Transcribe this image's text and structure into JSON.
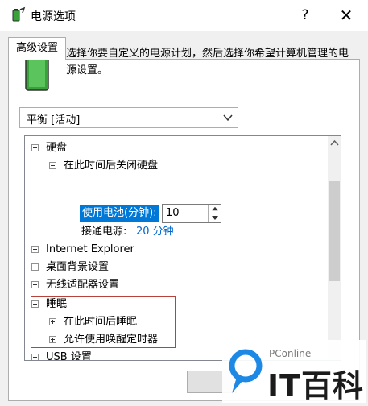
{
  "window": {
    "title": "电源选项",
    "help_label": "?",
    "close_label": "✕"
  },
  "tabs": [
    {
      "label": "高级设置"
    }
  ],
  "description": "选择你要自定义的电源计划，然后选择你希望计算机管理的电源设置。",
  "plan_select": {
    "value": "平衡 [活动]"
  },
  "settings_tree": {
    "hard_disk": {
      "label": "硬盘",
      "turn_off_after": {
        "label": "在此时间后关闭硬盘",
        "on_battery_label": "使用电池(分钟):",
        "on_battery_value": "10",
        "plugged_in_label": "接通电源:",
        "plugged_in_value": "20 分钟"
      }
    },
    "internet_explorer": {
      "label": "Internet Explorer"
    },
    "desktop_background": {
      "label": "桌面背景设置"
    },
    "wireless_adapter": {
      "label": "无线适配器设置"
    },
    "sleep": {
      "label": "睡眠",
      "sleep_after": {
        "label": "在此时间后睡眠"
      },
      "allow_wake_timers": {
        "label": "允许使用唤醒定时器"
      }
    },
    "usb": {
      "label": "USB 设置"
    }
  },
  "watermark": {
    "small": "PConline",
    "big": "IT百科"
  },
  "colors": {
    "highlight": "#0078d7",
    "link": "#0066cc",
    "red_outline": "#b8413a",
    "battery_green": "#3aa23a"
  }
}
